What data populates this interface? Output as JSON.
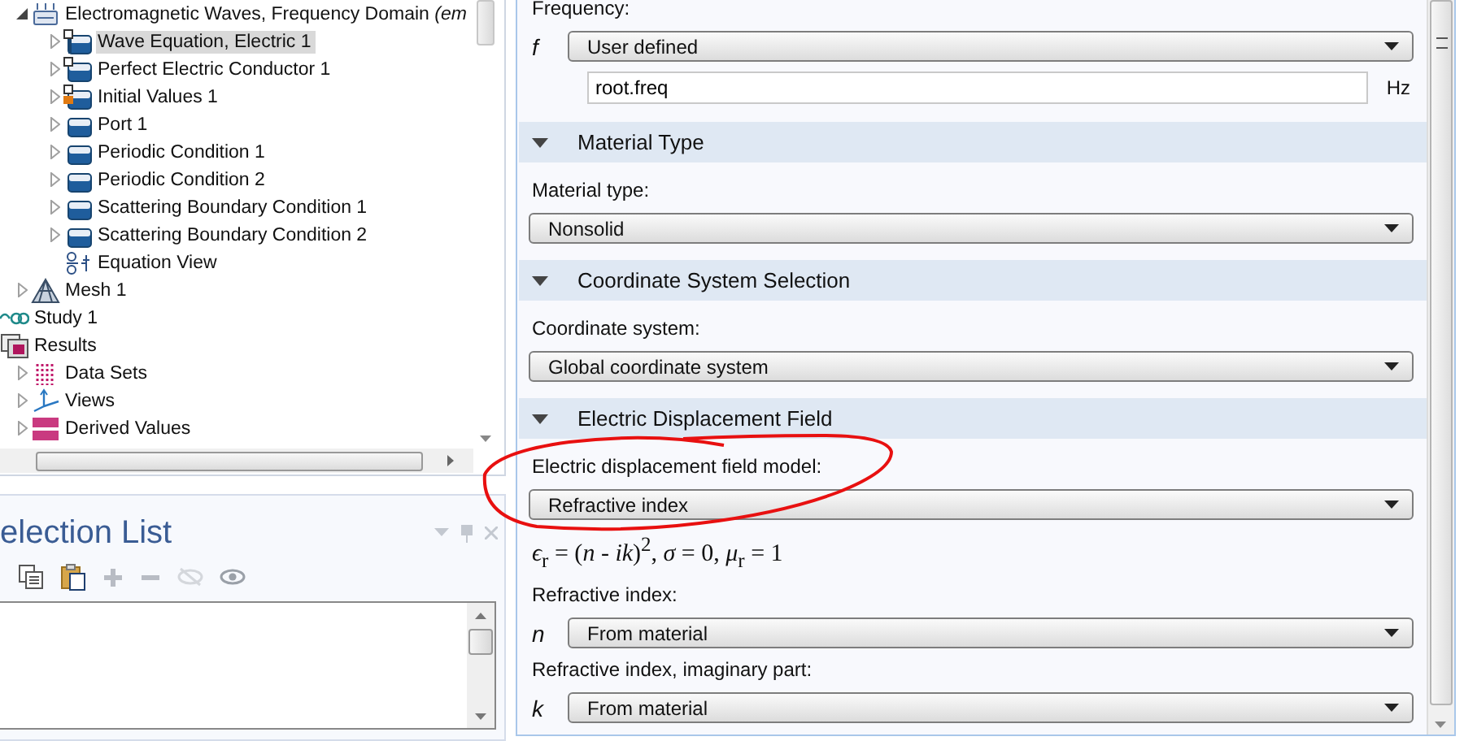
{
  "tree": {
    "partial_branch": [
      {
        "label": "Electromagnetic Waves, Frequency Domain *(em*",
        "kind": "physics",
        "expanded": true,
        "selected": false,
        "children": [
          {
            "label": "Wave Equation, Electric 1",
            "kind": "domain-default",
            "expanded": false,
            "selected": true
          },
          {
            "label": "Perfect Electric Conductor 1",
            "kind": "boundary-default",
            "expanded": false,
            "selected": false
          },
          {
            "label": "Initial Values 1",
            "kind": "initial-default",
            "expanded": false,
            "selected": false
          },
          {
            "label": "Port 1",
            "kind": "boundary",
            "expanded": false,
            "selected": false
          },
          {
            "label": "Periodic Condition 1",
            "kind": "boundary",
            "expanded": false,
            "selected": false
          },
          {
            "label": "Periodic Condition 2",
            "kind": "boundary",
            "expanded": false,
            "selected": false
          },
          {
            "label": "Scattering Boundary Condition 1",
            "kind": "boundary",
            "expanded": false,
            "selected": false
          },
          {
            "label": "Scattering Boundary Condition 2",
            "kind": "boundary",
            "expanded": false,
            "selected": false
          },
          {
            "label": "Equation View",
            "kind": "equation",
            "selected": false
          }
        ]
      },
      {
        "label": "Mesh 1",
        "kind": "mesh",
        "expanded": false,
        "selected": false
      }
    ],
    "items": [
      {
        "label": "Study 1",
        "kind": "study",
        "selected": false
      },
      {
        "label": "Results",
        "kind": "results",
        "selected": false,
        "children": [
          {
            "label": "Data Sets",
            "kind": "datasets",
            "expanded": false,
            "selected": false
          },
          {
            "label": "Views",
            "kind": "views",
            "expanded": false,
            "selected": false
          },
          {
            "label": "Derived Values",
            "kind": "derived",
            "expanded": false,
            "selected": false
          }
        ]
      }
    ]
  },
  "selection_list": {
    "title": "election List"
  },
  "settings": {
    "frequency": {
      "label": "Frequency:",
      "symbol": "f",
      "source": "User defined",
      "value": "root.freq",
      "unit": "Hz"
    },
    "sections": [
      {
        "title": "Material Type",
        "expanded": true,
        "fields": [
          {
            "kind": "select",
            "label": "Material type:",
            "value": "Nonsolid"
          }
        ]
      },
      {
        "title": "Coordinate System Selection",
        "expanded": true,
        "fields": [
          {
            "kind": "select",
            "label": "Coordinate system:",
            "value": "Global coordinate system"
          }
        ]
      },
      {
        "title": "Electric Displacement Field",
        "expanded": true,
        "fields": [
          {
            "kind": "select",
            "label": "Electric displacement field model:",
            "value": "Refractive index"
          },
          {
            "kind": "equation",
            "text": "*ϵ*$_{r}$ = (*n* - *ik*)$^{2}$,  *σ* = 0,  *μ*$_{r}$ = 1"
          },
          {
            "kind": "select",
            "label": "Refractive index:",
            "symbol": "n",
            "value": "From material"
          },
          {
            "kind": "select",
            "label": "Refractive index, imaginary part:",
            "symbol": "k",
            "value": "From material"
          }
        ]
      }
    ]
  }
}
